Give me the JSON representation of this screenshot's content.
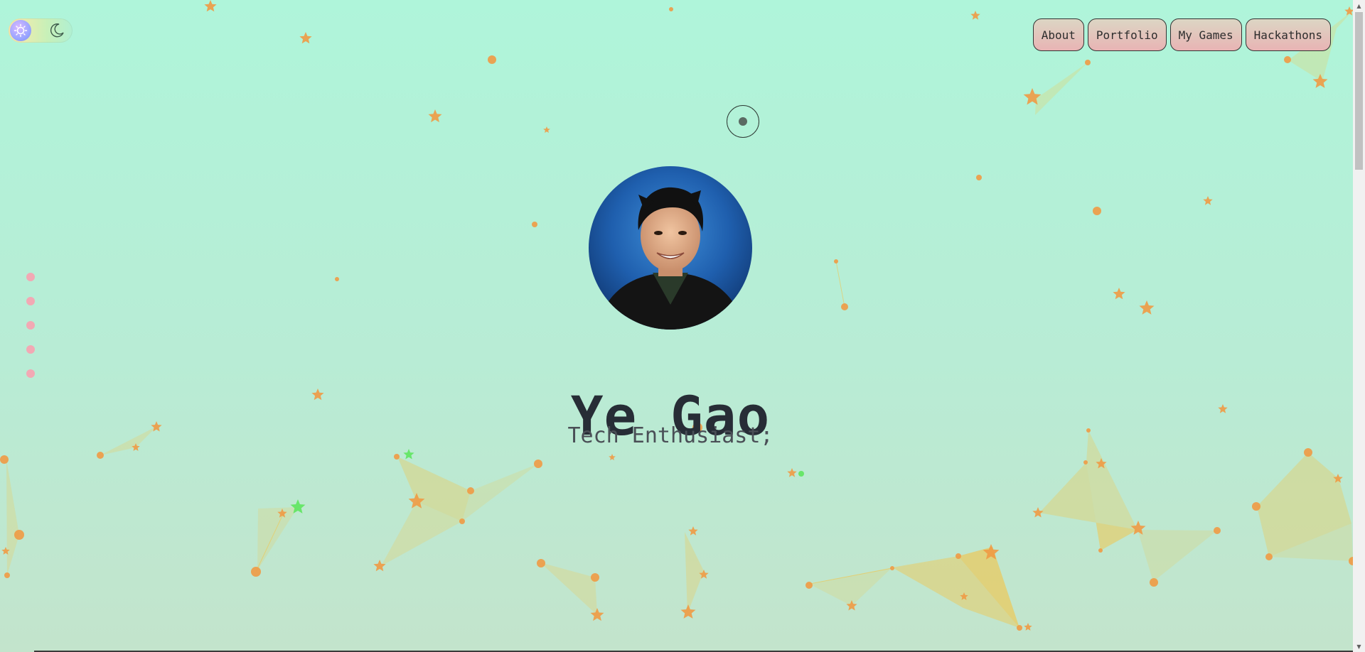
{
  "theme_toggle": {
    "sun_icon": "sun-icon",
    "moon_icon": "moon-icon"
  },
  "nav": {
    "items": [
      {
        "label": "About"
      },
      {
        "label": "Portfolio"
      },
      {
        "label": "My Games"
      },
      {
        "label": "Hackathons"
      }
    ]
  },
  "hero": {
    "name": "Ye Gao",
    "subtitle": "Tech Enthusiast;"
  },
  "section_nav": {
    "count": 5
  },
  "colors": {
    "background_top": "#aff5da",
    "background_bottom": "#c3e4cc",
    "particle": "#ef9a44",
    "particle_highlight": "#5ee65e",
    "web_fill": "#f2c64e",
    "nav_button_top": "#dcd6c4",
    "nav_button_bottom": "#e8b4b4",
    "section_dot": "#f2a9b4",
    "text_primary": "#272d36"
  }
}
